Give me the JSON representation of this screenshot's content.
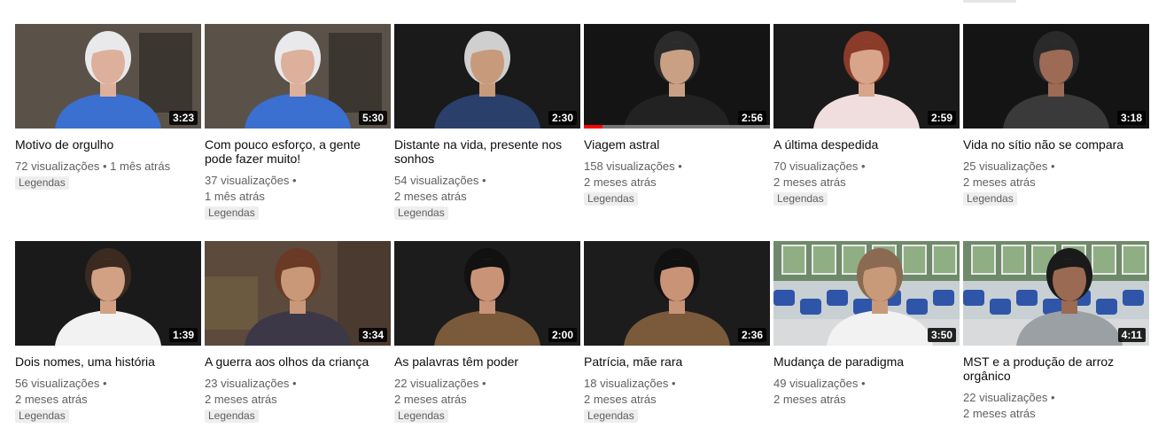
{
  "videos": [
    {
      "title": "Motivo de orgulho",
      "duration": "3:23",
      "views": "72 visualizações",
      "age": "1 mês atrás",
      "badge": "Legendas",
      "thumb": "elderly-woman-blue",
      "bg": "#5a5248",
      "shirt": "#3b6fd0",
      "hair": "#e9e9ec",
      "skin": "#dcb09a",
      "progress": 0
    },
    {
      "title": "Com pouco esforço, a gente pode fazer muito!",
      "duration": "5:30",
      "views": "37 visualizações",
      "age": "1 mês atrás",
      "badge": "Legendas",
      "thumb": "elderly-woman-blue",
      "bg": "#5a5248",
      "shirt": "#3b6fd0",
      "hair": "#e9e9ec",
      "skin": "#dcb09a",
      "progress": 0
    },
    {
      "title": "Distante na vida, presente nos sonhos",
      "duration": "2:30",
      "views": "54 visualizações",
      "age": "2 meses atrás",
      "badge": "Legendas",
      "thumb": "elderly-woman-patterned",
      "bg": "#1a1a1a",
      "shirt": "#2a3f6a",
      "hair": "#cfcfcf",
      "skin": "#c79a7c",
      "progress": 0
    },
    {
      "title": "Viagem astral",
      "duration": "2:56",
      "views": "158 visualizações",
      "age": "2 meses atrás",
      "badge": "Legendas",
      "thumb": "man-dark-shirt",
      "bg": "#141414",
      "shirt": "#222222",
      "hair": "#2b2b2b",
      "skin": "#c9a084",
      "progress": 0.1
    },
    {
      "title": "A última despedida",
      "duration": "2:59",
      "views": "70 visualizações",
      "age": "2 meses atrás",
      "badge": "Legendas",
      "thumb": "woman-white-blouse",
      "bg": "#1a1a1a",
      "shirt": "#f0dede",
      "hair": "#8a3b2a",
      "skin": "#d8a48a",
      "progress": 0
    },
    {
      "title": "Vida no sítio não se compara",
      "duration": "3:18",
      "views": "25 visualizações",
      "age": "2 meses atrás",
      "badge": "Legendas",
      "thumb": "woman-dark-patterned",
      "bg": "#141414",
      "shirt": "#3a3a3a",
      "hair": "#2a2a2a",
      "skin": "#9c6a55",
      "progress": 0
    },
    {
      "title": "Dois nomes, uma história",
      "duration": "1:39",
      "views": "56 visualizações",
      "age": "2 meses atrás",
      "badge": "Legendas",
      "thumb": "man-white-shirt",
      "bg": "#1a1a1a",
      "shirt": "#f2f2f2",
      "hair": "#3a2a20",
      "skin": "#d2a184",
      "progress": 0
    },
    {
      "title": "A guerra aos olhos da criança",
      "duration": "3:34",
      "views": "23 visualizações",
      "age": "2 meses atrás",
      "badge": "Legendas",
      "thumb": "elderly-woman-room",
      "bg": "#5c4a3c",
      "shirt": "#3c3848",
      "hair": "#6b3a26",
      "skin": "#c89878",
      "progress": 0
    },
    {
      "title": "As palavras têm poder",
      "duration": "2:00",
      "views": "22 visualizações",
      "age": "2 meses atrás",
      "badge": "Legendas",
      "thumb": "woman-leopard",
      "bg": "#1c1c1c",
      "shirt": "#7a5a3a",
      "hair": "#111111",
      "skin": "#c99378",
      "progress": 0
    },
    {
      "title": "Patrícia, mãe rara",
      "duration": "2:36",
      "views": "18 visualizações",
      "age": "2 meses atrás",
      "badge": "Legendas",
      "thumb": "woman-leopard",
      "bg": "#1c1c1c",
      "shirt": "#7a5a3a",
      "hair": "#111111",
      "skin": "#c99378",
      "progress": 0
    },
    {
      "title": "Mudança de paradigma",
      "duration": "3:50",
      "views": "49 visualizações",
      "age": "2 meses atrás",
      "badge": "",
      "thumb": "man-classroom",
      "bg": "#c8d0d4",
      "shirt": "#f2f2f2",
      "hair": "#8a6a50",
      "skin": "#c99a7a",
      "progress": 0
    },
    {
      "title": "MST e a produção de arroz orgânico",
      "duration": "4:11",
      "views": "22 visualizações",
      "age": "2 meses atrás",
      "badge": "",
      "thumb": "man-classroom-gray",
      "bg": "#c8d0d4",
      "shirt": "#9aa0a4",
      "hair": "#1a1a1a",
      "skin": "#9a6a52",
      "progress": 0
    }
  ]
}
